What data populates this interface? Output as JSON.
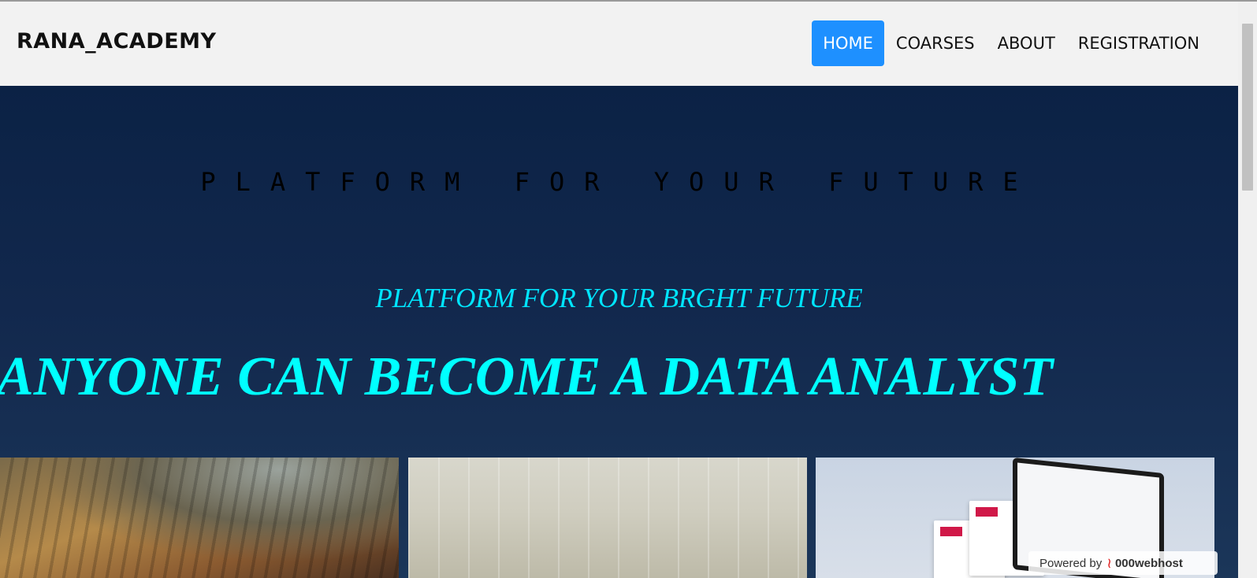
{
  "brand": "RANA_ACADEMY",
  "nav": {
    "items": [
      "HOME",
      "COARSES",
      "ABOUT",
      "REGISTRATION"
    ],
    "active": "HOME"
  },
  "hero": {
    "tagline": "PLATFORM FOR YOUR FUTURE",
    "subtitle": "PLATFORM FOR YOUR BRGHT FUTURE",
    "headline": "ANYONE CAN BECOME A DATA ANALYST"
  },
  "badge": {
    "prefix": "Powered by",
    "brand": "000webhost"
  },
  "colors": {
    "nav_bg": "#f2f2f2",
    "active_nav": "#1e90ff",
    "hero_bg": "#12284d",
    "accent_cyan": "#00ffff"
  }
}
